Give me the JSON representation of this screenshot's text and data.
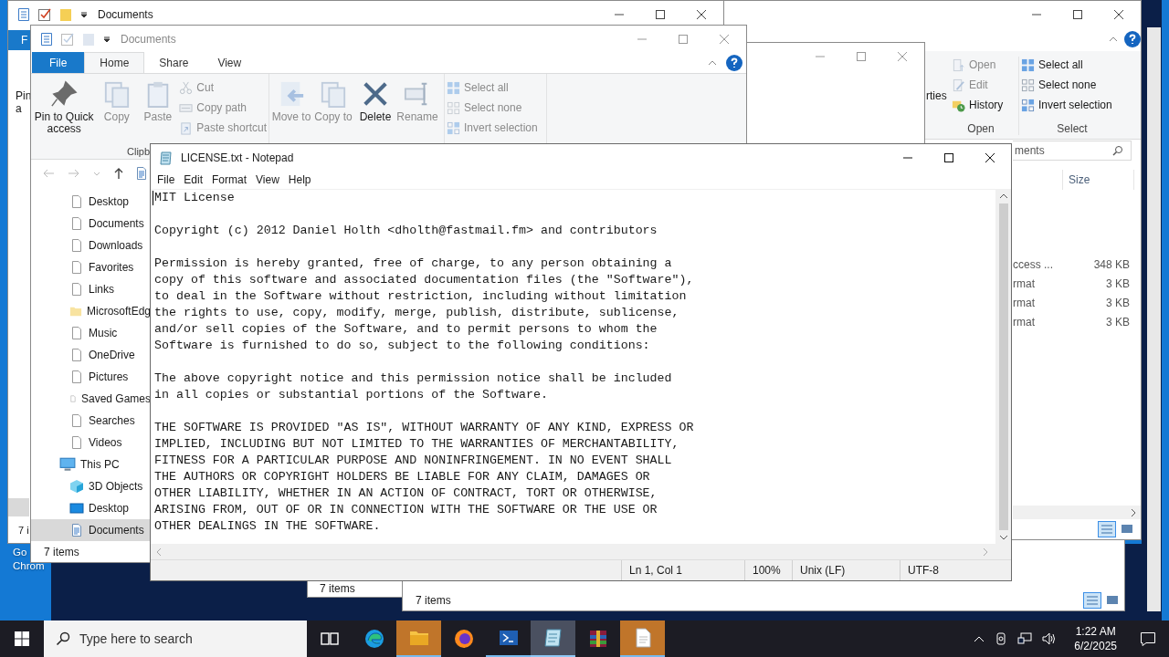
{
  "desktop": {
    "icon_label_lines": [
      "Go",
      "Chrom"
    ]
  },
  "back_explorer": {
    "title": "Documents",
    "file_tab": "F",
    "ribbon_fragments": [
      "Pin",
      "a"
    ],
    "status": "7 i"
  },
  "right_explorer": {
    "ribbon_fragment": "rties",
    "open_group": {
      "label": "Open",
      "items": [
        {
          "label": "Open",
          "kind": "open",
          "disabled": true
        },
        {
          "label": "Edit",
          "kind": "edit",
          "disabled": true
        },
        {
          "label": "History",
          "kind": "history",
          "disabled": false
        }
      ]
    },
    "select_group": {
      "label": "Select",
      "items": [
        {
          "label": "Select all",
          "kind": "select-all",
          "disabled": false
        },
        {
          "label": "Select none",
          "kind": "select-none",
          "disabled": false
        },
        {
          "label": "Invert selection",
          "kind": "invert-selection",
          "disabled": false
        }
      ]
    },
    "search_text": "ments",
    "size_header": "Size",
    "rows": [
      {
        "name": "ccess ...",
        "size": "348 KB"
      },
      {
        "name": "rmat",
        "size": "3 KB"
      },
      {
        "name": "rmat",
        "size": "3 KB"
      },
      {
        "name": "rmat",
        "size": "3 KB"
      }
    ]
  },
  "middle_explorer": {
    "status": "7 items"
  },
  "lower_explorer": {
    "status": "7 items"
  },
  "front_explorer": {
    "title": "Documents",
    "tabs": [
      {
        "label": "File",
        "kind": "file",
        "selected": false
      },
      {
        "label": "Home",
        "kind": "tab",
        "selected": true
      },
      {
        "label": "Share",
        "kind": "tab",
        "selected": false
      },
      {
        "label": "View",
        "kind": "tab",
        "selected": false
      }
    ],
    "clipboard_group": {
      "label": "Clipb",
      "big": [
        {
          "label": "Pin to Quick access",
          "kind": "pin",
          "disabled": false
        },
        {
          "label": "Copy",
          "kind": "copy",
          "disabled": true
        },
        {
          "label": "Paste",
          "kind": "paste",
          "disabled": true
        }
      ],
      "small": [
        {
          "label": "Cut",
          "kind": "cut",
          "disabled": true
        },
        {
          "label": "Copy path",
          "kind": "copy-path",
          "disabled": true
        },
        {
          "label": "Paste shortcut",
          "kind": "paste-shortcut",
          "disabled": true
        }
      ]
    },
    "organize_group": [
      {
        "label": "Move to",
        "kind": "move-to",
        "disabled": true
      },
      {
        "label": "Copy to",
        "kind": "copy-to",
        "disabled": true
      },
      {
        "label": "Delete",
        "kind": "delete",
        "disabled": false
      },
      {
        "label": "Rename",
        "kind": "rename",
        "disabled": true
      }
    ],
    "select_group": [
      {
        "label": "Select all",
        "kind": "select-all",
        "disabled": true
      },
      {
        "label": "Select none",
        "kind": "select-none",
        "disabled": true
      },
      {
        "label": "Invert selection",
        "kind": "invert-selection",
        "disabled": true
      }
    ],
    "user_folders": [
      {
        "label": "Desktop",
        "kind": "page",
        "selected": false
      },
      {
        "label": "Documents",
        "kind": "page",
        "selected": false
      },
      {
        "label": "Downloads",
        "kind": "page",
        "selected": false
      },
      {
        "label": "Favorites",
        "kind": "page",
        "selected": false
      },
      {
        "label": "Links",
        "kind": "page",
        "selected": false
      },
      {
        "label": "MicrosoftEdg",
        "kind": "folder",
        "selected": false
      },
      {
        "label": "Music",
        "kind": "page",
        "selected": false
      },
      {
        "label": "OneDrive",
        "kind": "page",
        "selected": false
      },
      {
        "label": "Pictures",
        "kind": "page",
        "selected": false
      },
      {
        "label": "Saved Games",
        "kind": "page",
        "selected": false
      },
      {
        "label": "Searches",
        "kind": "page",
        "selected": false
      },
      {
        "label": "Videos",
        "kind": "page",
        "selected": false
      }
    ],
    "this_pc": {
      "label": "This PC",
      "kind": "pc",
      "selected": false,
      "children": [
        {
          "label": "3D Objects",
          "kind": "cube",
          "selected": false
        },
        {
          "label": "Desktop",
          "kind": "desktop",
          "selected": false
        },
        {
          "label": "Documents",
          "kind": "docs",
          "selected": true
        }
      ]
    },
    "status": "7 items"
  },
  "notepad": {
    "title": "LICENSE.txt - Notepad",
    "menu": [
      "File",
      "Edit",
      "Format",
      "View",
      "Help"
    ],
    "paragraphs": [
      "MIT License",
      "Copyright (c) 2012 Daniel Holth <dholth@fastmail.fm> and contributors",
      "Permission is hereby granted, free of charge, to any person obtaining a\ncopy of this software and associated documentation files (the \"Software\"),\nto deal in the Software without restriction, including without limitation\nthe rights to use, copy, modify, merge, publish, distribute, sublicense,\nand/or sell copies of the Software, and to permit persons to whom the\nSoftware is furnished to do so, subject to the following conditions:",
      "The above copyright notice and this permission notice shall be included\nin all copies or substantial portions of the Software.",
      "THE SOFTWARE IS PROVIDED \"AS IS\", WITHOUT WARRANTY OF ANY KIND, EXPRESS OR\nIMPLIED, INCLUDING BUT NOT LIMITED TO THE WARRANTIES OF MERCHANTABILITY,\nFITNESS FOR A PARTICULAR PURPOSE AND NONINFRINGEMENT. IN NO EVENT SHALL\nTHE AUTHORS OR COPYRIGHT HOLDERS BE LIABLE FOR ANY CLAIM, DAMAGES OR\nOTHER LIABILITY, WHETHER IN AN ACTION OF CONTRACT, TORT OR OTHERWISE,\nARISING FROM, OUT OF OR IN CONNECTION WITH THE SOFTWARE OR THE USE OR\nOTHER DEALINGS IN THE SOFTWARE."
    ],
    "status": [
      "Ln 1, Col 1",
      "100%",
      "Unix (LF)",
      "UTF-8"
    ]
  },
  "taskbar": {
    "search_placeholder": "Type here to search",
    "apps": [
      {
        "kind": "taskview",
        "running": false,
        "active": false,
        "flashing": false
      },
      {
        "kind": "edge",
        "running": false,
        "active": false,
        "flashing": false
      },
      {
        "kind": "folder",
        "running": true,
        "active": false,
        "flashing": true
      },
      {
        "kind": "firefox",
        "running": false,
        "active": false,
        "flashing": false
      },
      {
        "kind": "terminal",
        "running": true,
        "active": false,
        "flashing": false
      },
      {
        "kind": "notepad",
        "running": true,
        "active": true,
        "flashing": false
      },
      {
        "kind": "archive",
        "running": false,
        "active": false,
        "flashing": false
      },
      {
        "kind": "document",
        "running": true,
        "active": false,
        "flashing": true
      }
    ],
    "time": "1:22 AM",
    "date": "6/2/2025"
  }
}
